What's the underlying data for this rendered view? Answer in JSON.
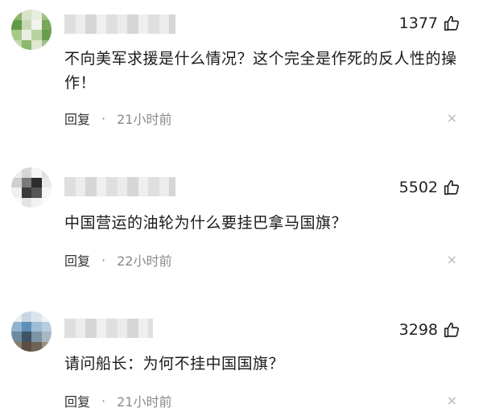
{
  "comments": [
    {
      "likes": "1377",
      "text": "不向美军求援是什么情况？这个完全是作死的反人性的操作！",
      "reply_label": "回复",
      "dot": "·",
      "time": "21小时前",
      "dismiss": "×"
    },
    {
      "likes": "5502",
      "text": "中国营运的油轮为什么要挂巴拿马国旗？",
      "reply_label": "回复",
      "dot": "·",
      "time": "22小时前",
      "dismiss": "×"
    },
    {
      "likes": "3298",
      "text": "请问船长：为何不挂中国国旗？",
      "reply_label": "回复",
      "dot": "·",
      "time": "21小时前",
      "dismiss": "×"
    }
  ],
  "icons": {
    "like": "thumbs-up-icon",
    "close": "close-icon"
  }
}
